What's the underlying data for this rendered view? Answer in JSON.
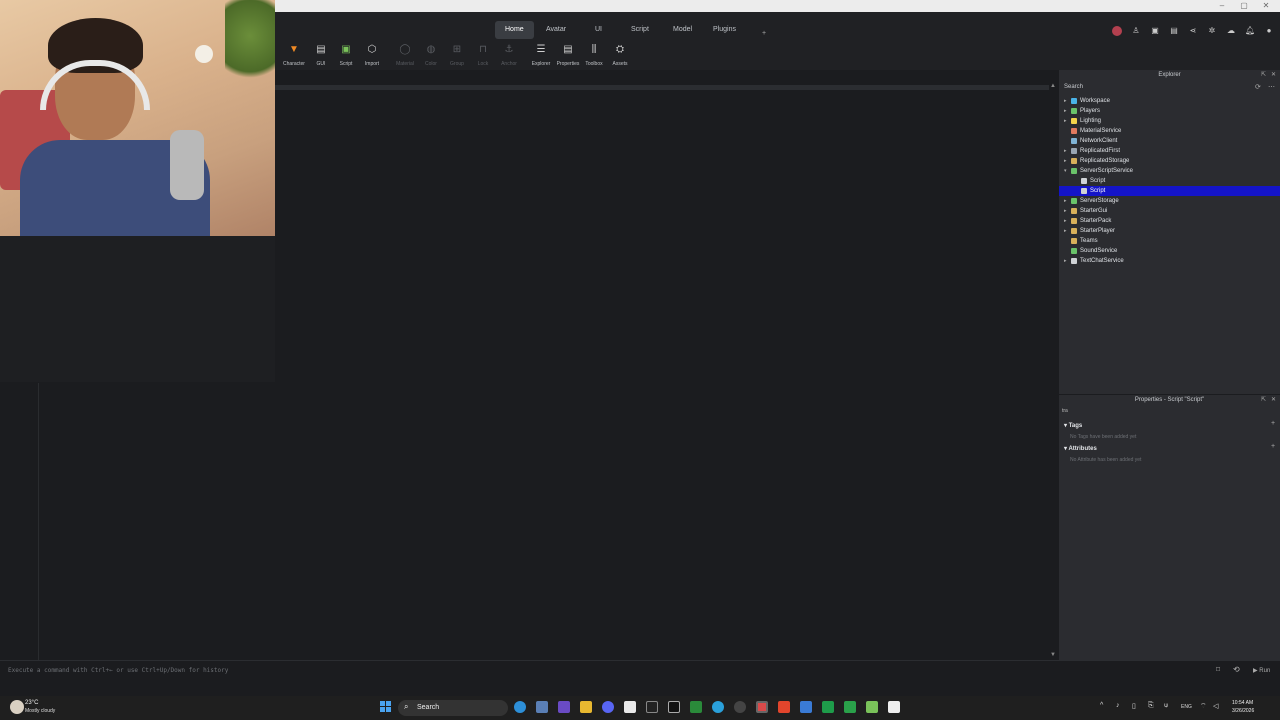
{
  "ribbon": {
    "tabs": [
      "Home",
      "Avatar",
      "UI",
      "Script",
      "Model",
      "Plugins"
    ],
    "more": "+"
  },
  "toolbar": {
    "tools": [
      {
        "label": "Character",
        "icon": "character-icon"
      },
      {
        "label": "GUI",
        "icon": "gui-icon"
      },
      {
        "label": "Script",
        "icon": "script-icon"
      },
      {
        "label": "Import",
        "icon": "import-icon"
      },
      {
        "label": "Material",
        "icon": "material-icon"
      },
      {
        "label": "Color",
        "icon": "color-icon"
      },
      {
        "label": "Group",
        "icon": "group-icon"
      },
      {
        "label": "Lock",
        "icon": "lock-icon"
      },
      {
        "label": "Anchor",
        "icon": "anchor-icon"
      },
      {
        "label": "Explorer",
        "icon": "explorer-icon"
      },
      {
        "label": "Properties",
        "icon": "properties-icon"
      },
      {
        "label": "Toolbox",
        "icon": "toolbox-icon"
      },
      {
        "label": "Assets",
        "icon": "assets-icon"
      }
    ]
  },
  "explorer": {
    "title": "Explorer",
    "search_placeholder": "Search",
    "items": [
      {
        "label": "Workspace",
        "icon_color": "#4ab3e8"
      },
      {
        "label": "Players",
        "icon_color": "#6ac36a"
      },
      {
        "label": "Lighting",
        "icon_color": "#f2d34a"
      },
      {
        "label": "MaterialService",
        "icon_color": "#e07a5f"
      },
      {
        "label": "NetworkClient",
        "icon_color": "#7fb3d5"
      },
      {
        "label": "ReplicatedFirst",
        "icon_color": "#9aa6b2"
      },
      {
        "label": "ReplicatedStorage",
        "icon_color": "#d8b05a"
      },
      {
        "label": "ServerScriptService",
        "icon_color": "#6ac36a"
      },
      {
        "label": "Script",
        "icon_color": "#cfd2d6"
      },
      {
        "label": "Script",
        "icon_color": "#cfd2d6"
      },
      {
        "label": "ServerStorage",
        "icon_color": "#6ac36a"
      },
      {
        "label": "StarterGui",
        "icon_color": "#d8b05a"
      },
      {
        "label": "StarterPack",
        "icon_color": "#d8b05a"
      },
      {
        "label": "StarterPlayer",
        "icon_color": "#d8b05a"
      },
      {
        "label": "Teams",
        "icon_color": "#d8b05a"
      },
      {
        "label": "SoundService",
        "icon_color": "#6ac36a"
      },
      {
        "label": "TextChatService",
        "icon_color": "#cfd2d6"
      }
    ]
  },
  "properties": {
    "title": "Properties - Script \"Script\"",
    "filter": "tra",
    "tags_label": "Tags",
    "tags_empty": "No Tags have been added yet",
    "attributes_label": "Attributes",
    "attributes_empty": "No Attribute has been added yet"
  },
  "command_bar": {
    "placeholder": "Execute a command with Ctrl+← or use Ctrl+Up/Down for history",
    "run_label": "Run"
  },
  "taskbar": {
    "temperature": "23°C",
    "weather": "Mostly cloudy",
    "search_label": "Search",
    "language": "ENG",
    "time": "10:54 AM",
    "date": "3/26/2026"
  }
}
